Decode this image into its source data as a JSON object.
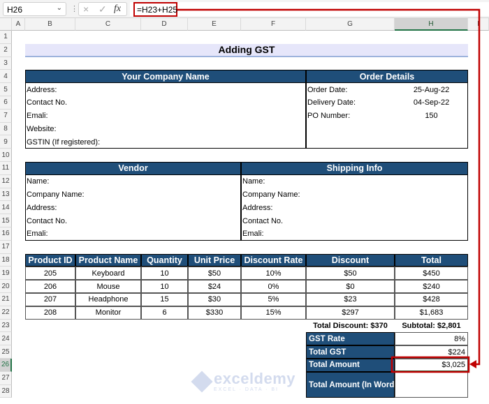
{
  "formula_bar": {
    "name_box": "H26",
    "cancel_icon": "×",
    "enter_icon": "✓",
    "fx_label": "fx",
    "formula": "=H23+H25"
  },
  "columns": [
    "A",
    "B",
    "C",
    "D",
    "E",
    "F",
    "G",
    "H",
    "I"
  ],
  "selected_cell": "H26",
  "title": "Adding GST",
  "company": {
    "header": "Your Company Name",
    "fields": [
      "Address:",
      "Contact No.",
      "Emali:",
      "Website:",
      "GSTIN (If registered):"
    ]
  },
  "order": {
    "header": "Order Details",
    "fields": [
      {
        "label": "Order Date:",
        "value": "25-Aug-22"
      },
      {
        "label": "Delivery Date:",
        "value": "04-Sep-22"
      },
      {
        "label": "PO Number:",
        "value": "150"
      }
    ]
  },
  "vendor": {
    "header": "Vendor",
    "fields": [
      "Name:",
      "Company Name:",
      "Address:",
      "Contact No.",
      "Emali:"
    ]
  },
  "shipping": {
    "header": "Shipping Info",
    "fields": [
      "Name:",
      "Company Name:",
      "Address:",
      "Contact No.",
      "Emali:"
    ]
  },
  "products": {
    "headers": [
      "Product ID",
      "Product Name",
      "Quantity",
      "Unit Price",
      "Discount Rate",
      "Discount",
      "Total"
    ],
    "rows": [
      [
        "205",
        "Keyboard",
        "10",
        "$50",
        "10%",
        "$50",
        "$450"
      ],
      [
        "206",
        "Mouse",
        "10",
        "$24",
        "0%",
        "$0",
        "$240"
      ],
      [
        "207",
        "Headphone",
        "15",
        "$30",
        "5%",
        "$23",
        "$428"
      ],
      [
        "208",
        "Monitor",
        "6",
        "$330",
        "15%",
        "$297",
        "$1,683"
      ]
    ]
  },
  "totals": {
    "total_discount": "Total Discount: $370",
    "subtotal": "Subtotal: $2,801",
    "gst_rate_label": "GST Rate",
    "gst_rate": "8%",
    "total_gst_label": "Total GST",
    "total_gst": "$224",
    "total_amount_label": "Total Amount",
    "total_amount": "$3,025",
    "in_word_label": "Total Amount (In Word)",
    "in_word": ""
  },
  "watermark": {
    "name": "exceldemy",
    "tagline": "EXCEL · DATA · BI"
  },
  "colors": {
    "header_blue": "#1f4e79",
    "title_bg": "#e6e6fa",
    "highlight_red": "#c00000",
    "excel_green": "#217346"
  }
}
